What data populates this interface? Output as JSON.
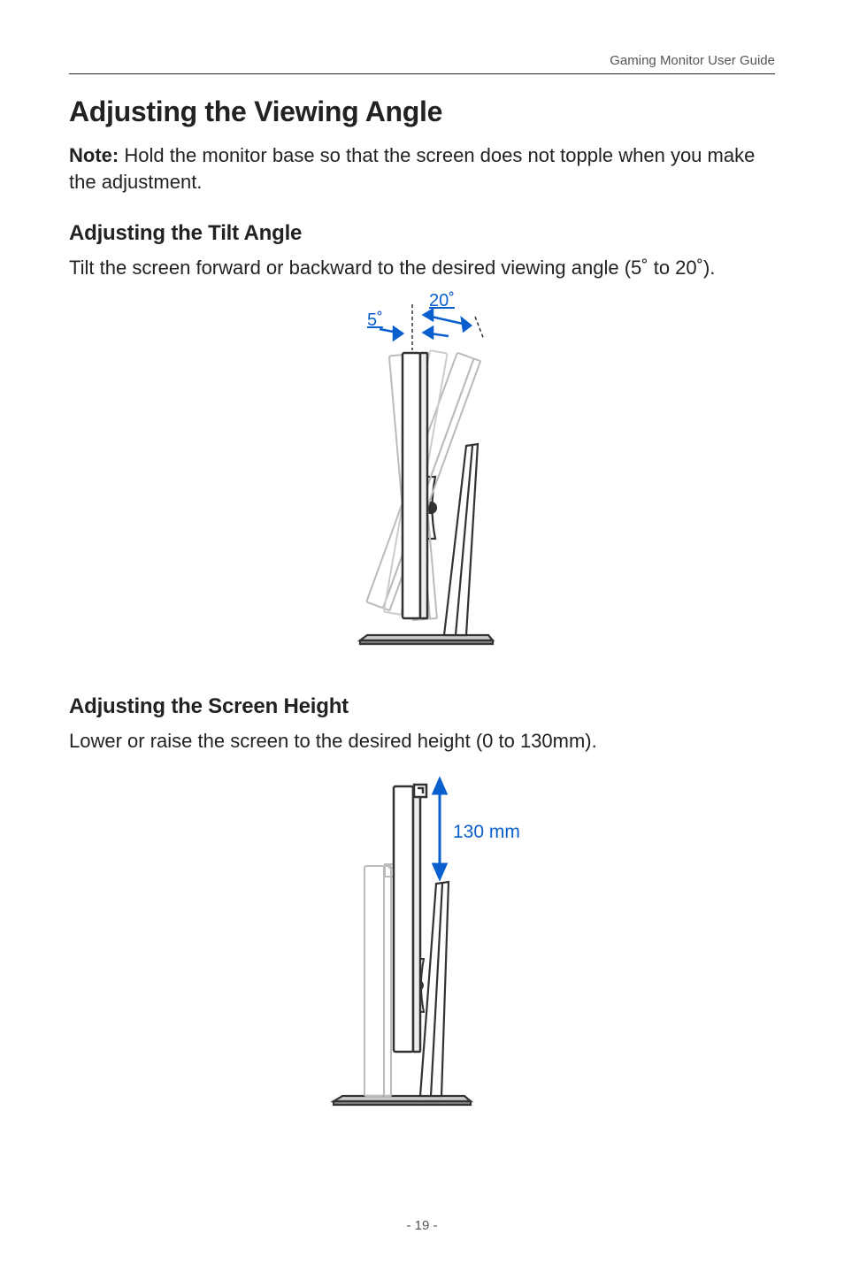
{
  "header": {
    "running_title": "Gaming Monitor User Guide"
  },
  "title": "Adjusting the Viewing Angle",
  "note": {
    "label": "Note:",
    "text": " Hold the monitor base so that the screen does not topple when you make the adjustment."
  },
  "tilt": {
    "heading": "Adjusting the Tilt Angle",
    "text": "Tilt the screen forward or backward to the desired viewing angle (5˚ to 20˚).",
    "label_forward": "5˚",
    "label_back": "20˚"
  },
  "height": {
    "heading": "Adjusting the Screen Height",
    "text": "Lower or raise the screen to the desired height (0 to 130mm).",
    "label": "130 mm"
  },
  "page_number": "- 19 -"
}
